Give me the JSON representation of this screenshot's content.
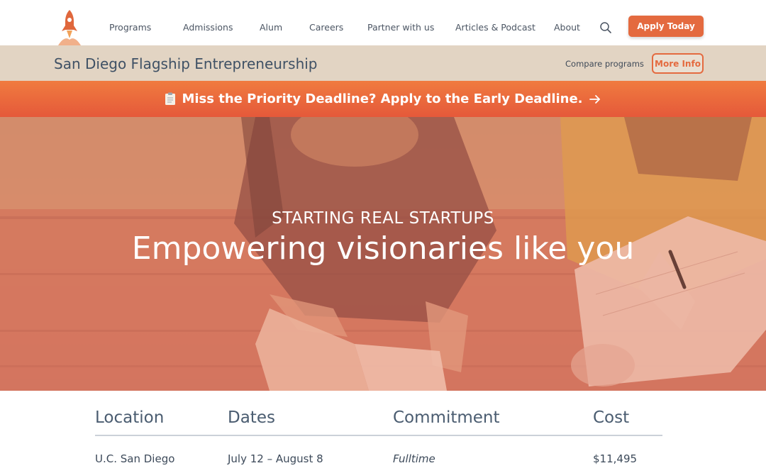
{
  "nav": {
    "items": [
      "Programs",
      "Admissions",
      "Alum",
      "Careers",
      "Partner with us",
      "Articles & Podcast",
      "About"
    ],
    "apply_label": "Apply Today"
  },
  "program_bar": {
    "title": "San Diego Flagship Entrepreneurship",
    "compare_label": "Compare programs",
    "more_info_label": "More Info"
  },
  "banner": {
    "text": "Miss the Priority Deadline? Apply to the Early Deadline."
  },
  "hero": {
    "eyebrow": "STARTING REAL STARTUPS",
    "title": "Empowering visionaries like you"
  },
  "info_table": {
    "headers": [
      "Location",
      "Dates",
      "Commitment",
      "Cost"
    ],
    "values": [
      "U.C. San Diego",
      "July 12 – August 8",
      "Fulltime",
      "$11,495"
    ]
  },
  "colors": {
    "accent": "#e46a3f",
    "banner": "#ec6a3c",
    "heading": "#3f5165"
  },
  "icons": {
    "logo": "rocket-icon",
    "search": "search-icon",
    "banner_left": "clipboard-icon",
    "banner_right": "arrow-right-icon"
  }
}
